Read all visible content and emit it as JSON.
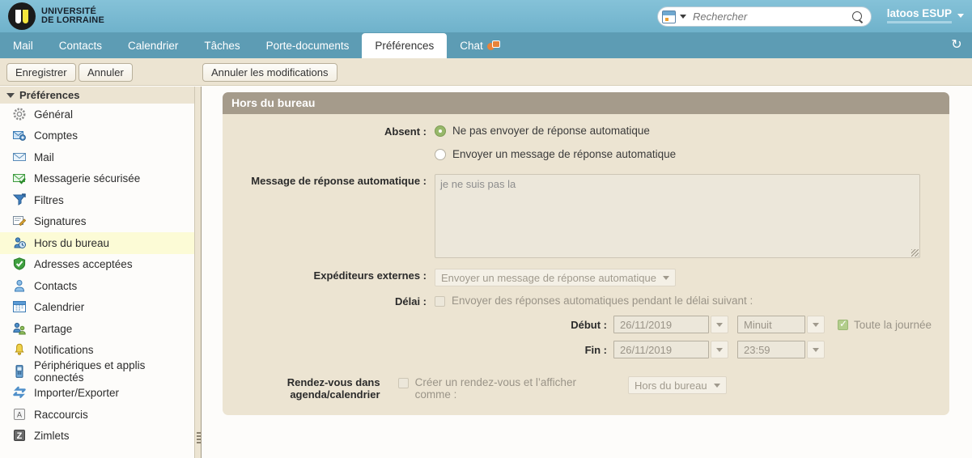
{
  "header": {
    "brand_line1": "UNIVERSITÉ",
    "brand_line2": "DE LORRAINE",
    "search_placeholder": "Rechercher",
    "search_value": "",
    "search_type_icon": "calendar-grid-icon",
    "search_submit_icon": "magnifier-icon",
    "user_name": "latoos ESUP",
    "accent_header": "#79b9d1"
  },
  "tabs": {
    "items": [
      {
        "label": "Mail",
        "active": false
      },
      {
        "label": "Contacts",
        "active": false
      },
      {
        "label": "Calendrier",
        "active": false
      },
      {
        "label": "Tâches",
        "active": false
      },
      {
        "label": "Porte-documents",
        "active": false
      },
      {
        "label": "Préférences",
        "active": true
      },
      {
        "label": "Chat",
        "active": false,
        "icon": "chat-people-icon"
      }
    ],
    "refresh_glyph": "↻",
    "bar_color": "#5d9cb4"
  },
  "toolbar": {
    "save_label": "Enregistrer",
    "cancel_label": "Annuler",
    "revert_label": "Annuler les modifications"
  },
  "sidebar": {
    "title": "Préférences",
    "items": [
      {
        "label": "Général",
        "icon": "gear-icon",
        "selected": false
      },
      {
        "label": "Comptes",
        "icon": "accounts-envelope-icon",
        "selected": false
      },
      {
        "label": "Mail",
        "icon": "envelope-icon",
        "selected": false
      },
      {
        "label": "Messagerie sécurisée",
        "icon": "secure-mail-icon",
        "selected": false
      },
      {
        "label": "Filtres",
        "icon": "filter-funnel-icon",
        "selected": false
      },
      {
        "label": "Signatures",
        "icon": "signature-pencil-icon",
        "selected": false
      },
      {
        "label": "Hors du bureau",
        "icon": "out-of-office-clock-icon",
        "selected": true
      },
      {
        "label": "Adresses acceptées",
        "icon": "shield-check-icon",
        "selected": false
      },
      {
        "label": "Contacts",
        "icon": "person-icon",
        "selected": false
      },
      {
        "label": "Calendrier",
        "icon": "calendar-icon",
        "selected": false
      },
      {
        "label": "Partage",
        "icon": "share-people-icon",
        "selected": false
      },
      {
        "label": "Notifications",
        "icon": "bell-icon",
        "selected": false
      },
      {
        "label": "Périphériques et applis connectés",
        "icon": "mobile-device-icon",
        "selected": false
      },
      {
        "label": "Importer/Exporter",
        "icon": "import-export-arrows-icon",
        "selected": false
      },
      {
        "label": "Raccourcis",
        "icon": "keyboard-key-icon",
        "selected": false
      },
      {
        "label": "Zimlets",
        "icon": "zimlet-z-icon",
        "selected": false
      }
    ],
    "selected_bg": "#fcfbd6"
  },
  "panel": {
    "title": "Hors du bureau",
    "header_bg": "#a59b8b",
    "body_bg": "#ece4d2",
    "absent": {
      "label": "Absent :",
      "options": [
        {
          "label": "Ne pas envoyer de réponse automatique",
          "selected": true
        },
        {
          "label": "Envoyer un message de réponse automatique",
          "selected": false
        }
      ],
      "selected_color": "#97b86a"
    },
    "auto_reply": {
      "label": "Message de réponse automatique :",
      "value": "je ne suis pas la",
      "disabled": true
    },
    "external_senders": {
      "label": "Expéditeurs externes :",
      "value": "Envoyer un message de réponse automatique",
      "disabled": true
    },
    "delay": {
      "label": "Délai :",
      "checkbox_label": "Envoyer des réponses automatiques pendant le délai suivant :",
      "checked": false,
      "start_label": "Début :",
      "start_date": "26/11/2019",
      "start_time": "Minuit",
      "end_label": "Fin :",
      "end_date": "26/11/2019",
      "end_time": "23:59",
      "all_day_label": "Toute la journée",
      "all_day_checked": true
    },
    "appointment": {
      "label_line1": "Rendez-vous dans",
      "label_line2": "agenda/calendrier",
      "checkbox_label_line1": "Créer un rendez-vous et l’afficher",
      "checkbox_label_line2": "comme :",
      "checked": false,
      "status_value": "Hors du bureau"
    }
  }
}
